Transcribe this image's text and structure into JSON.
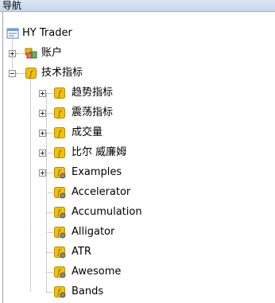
{
  "window": {
    "title": "导航"
  },
  "tree": {
    "root": {
      "label": "HY Trader",
      "icon": "terminal-icon"
    },
    "account": {
      "label": "账户",
      "icon": "accounts-icon",
      "expander": "plus"
    },
    "indicators": {
      "label": "技术指标",
      "icon": "indicator-folder-icon",
      "expander": "minus",
      "folders": [
        {
          "label": "趋势指标",
          "expander": "plus"
        },
        {
          "label": "震荡指标",
          "expander": "plus"
        },
        {
          "label": "成交量",
          "expander": "plus"
        },
        {
          "label": "比尔 威廉姆",
          "expander": "plus"
        },
        {
          "label": "Examples",
          "expander": "plus"
        }
      ],
      "items": [
        {
          "label": "Accelerator"
        },
        {
          "label": "Accumulation"
        },
        {
          "label": "Alligator"
        },
        {
          "label": "ATR"
        },
        {
          "label": "Awesome"
        },
        {
          "label": "Bands"
        }
      ]
    }
  },
  "colors": {
    "icon_yellow": "#f2c200",
    "icon_border": "#b88a00",
    "title_bar": "#c6d7ec"
  }
}
